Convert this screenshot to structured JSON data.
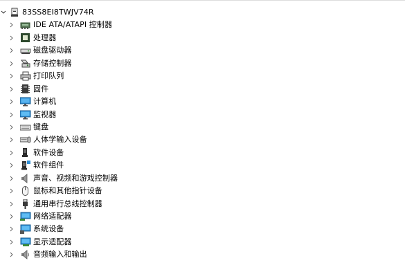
{
  "device_manager": {
    "root": {
      "label": "83SS8EI8TWJV74R",
      "icon": "computer-root-icon",
      "expanded": true
    },
    "categories": [
      {
        "label": "IDE ATA/ATAPI 控制器",
        "icon": "ide-controller-icon"
      },
      {
        "label": "处理器",
        "icon": "processor-icon"
      },
      {
        "label": "磁盘驱动器",
        "icon": "disk-drive-icon"
      },
      {
        "label": "存储控制器",
        "icon": "storage-controller-icon"
      },
      {
        "label": "打印队列",
        "icon": "printer-icon"
      },
      {
        "label": "固件",
        "icon": "firmware-icon"
      },
      {
        "label": "计算机",
        "icon": "computer-icon"
      },
      {
        "label": "监视器",
        "icon": "monitor-icon"
      },
      {
        "label": "键盘",
        "icon": "keyboard-icon"
      },
      {
        "label": "人体学输入设备",
        "icon": "hid-icon"
      },
      {
        "label": "软件设备",
        "icon": "software-device-icon"
      },
      {
        "label": "软件组件",
        "icon": "software-component-icon"
      },
      {
        "label": "声音、视频和游戏控制器",
        "icon": "sound-icon"
      },
      {
        "label": "鼠标和其他指针设备",
        "icon": "mouse-icon"
      },
      {
        "label": "通用串行总线控制器",
        "icon": "usb-icon"
      },
      {
        "label": "网络适配器",
        "icon": "network-adapter-icon"
      },
      {
        "label": "系统设备",
        "icon": "system-device-icon"
      },
      {
        "label": "显示适配器",
        "icon": "display-adapter-icon"
      },
      {
        "label": "音频输入和输出",
        "icon": "audio-io-icon"
      }
    ]
  }
}
